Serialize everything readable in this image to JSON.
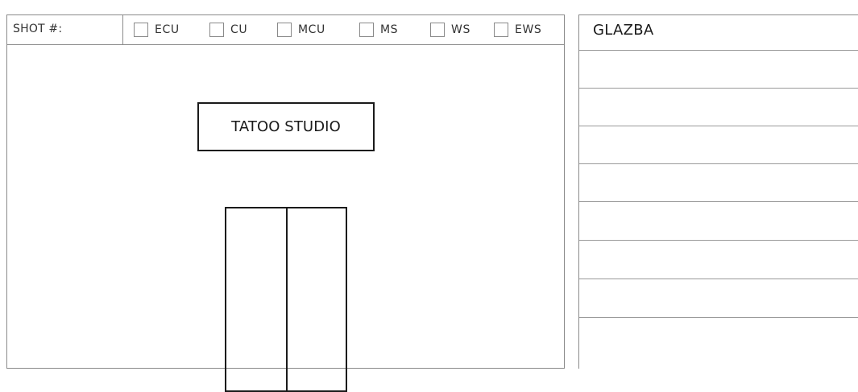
{
  "shot_panel": {
    "shot_label": "SHOT #:",
    "shot_size_options": [
      {
        "id": "ecu",
        "label": "ECU",
        "checked": false
      },
      {
        "id": "cu",
        "label": "CU",
        "checked": false
      },
      {
        "id": "mcu",
        "label": "MCU",
        "checked": false
      },
      {
        "id": "ms",
        "label": "MS",
        "checked": false
      },
      {
        "id": "ws",
        "label": "WS",
        "checked": false
      },
      {
        "id": "ews",
        "label": "EWS",
        "checked": false
      }
    ]
  },
  "sketch": {
    "sign_text": "TATOO STUDIO"
  },
  "music_panel": {
    "title": "GLAZBA"
  }
}
